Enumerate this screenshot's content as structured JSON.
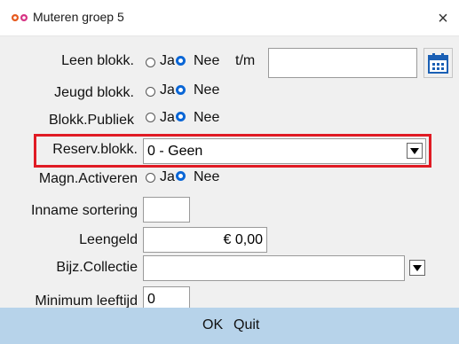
{
  "window": {
    "title": "Muteren groep 5",
    "close_label": "×",
    "accent": "#0a66d6",
    "highlight_color": "#e01b24",
    "footer_color": "#b7d3ea"
  },
  "form": {
    "leen_blokk": {
      "label": "Leen blokk.",
      "ja": "Ja",
      "nee": "Nee",
      "selected": "Nee",
      "tm_label": "t/m",
      "date_value": ""
    },
    "jeugd_blokk": {
      "label": "Jeugd blokk.",
      "ja": "Ja",
      "nee": "Nee",
      "selected": "Nee"
    },
    "blokk_publiek": {
      "label": "Blokk.Publiek",
      "ja": "Ja",
      "nee": "Nee",
      "selected": "Nee"
    },
    "reserv_blokk": {
      "label": "Reserv.blokk.",
      "value": "0 - Geen"
    },
    "magn_activeren": {
      "label": "Magn.Activeren",
      "ja": "Ja",
      "nee": "Nee",
      "selected": "Nee"
    },
    "inname_sortering": {
      "label": "Inname sortering",
      "value": ""
    },
    "leengeld": {
      "label": "Leengeld",
      "value": "€ 0,00"
    },
    "bijz_collectie": {
      "label": "Bijz.Collectie",
      "value": ""
    },
    "minimum_leeftijd": {
      "label": "Minimum leeftijd",
      "value": "0"
    }
  },
  "footer": {
    "ok_label": "OK",
    "quit_label": "Quit"
  },
  "icons": {
    "app": "glasses-icon",
    "calendar": "calendar-icon",
    "dropdown": "dropdown-arrow-icon"
  }
}
